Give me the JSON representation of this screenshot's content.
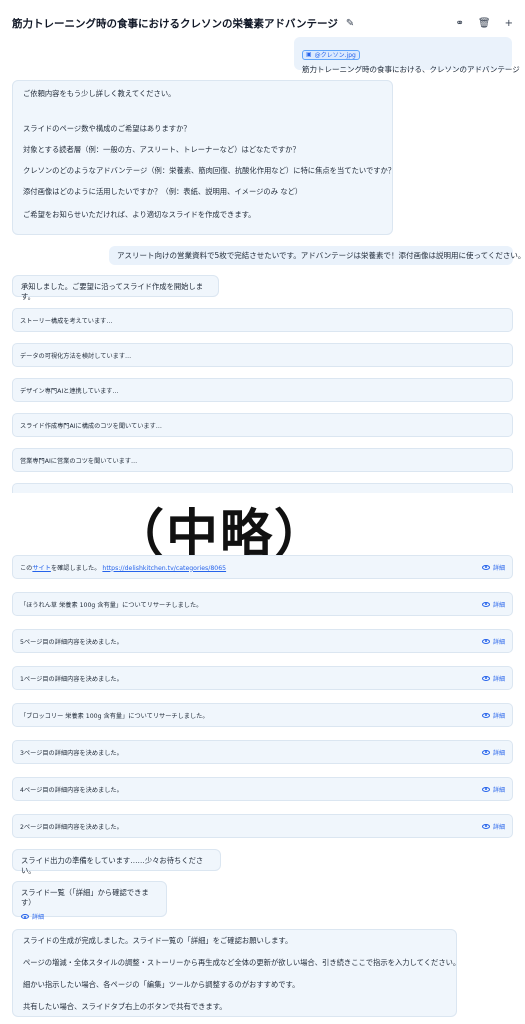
{
  "header": {
    "title": "筋力トレーニング時の食事におけるクレソンの栄養素アドバンテージ",
    "edit_icon": "pencil-icon",
    "actions": [
      "link-icon",
      "trash-icon",
      "plus-icon"
    ]
  },
  "user_msg_1": {
    "attachment": "@クレソン.jpg",
    "text": "筋力トレーニング時の食事における、クレソンのアドバンテージ"
  },
  "ai_msg_1": {
    "lines": [
      "ご依頼内容をもう少し詳しく教えてください。",
      "スライドのページ数や構成のご希望はありますか？",
      "対象とする読者層（例：一般の方、アスリート、トレーナーなど）はどなたですか？",
      "クレソンのどのようなアドバンテージ（例：栄養素、筋肉回復、抗酸化作用など）に特に焦点を当てたいですか？",
      "添付画像はどのように活用したいですか？（例：表紙、説明用、イメージのみ など）",
      "ご希望をお知らせいただければ、より適切なスライドを作成できます。"
    ]
  },
  "user_msg_2": {
    "text": "アスリート向けの営業資料で5枚で完結させたいです。アドバンテージは栄養素で！添付画像は説明用に使ってください。"
  },
  "ai_ack": "承知しました。ご要望に沿ってスライド作成を開始します。",
  "progress_steps": [
    "ストーリー構成を考えています…",
    "データの可視化方法を検討しています…",
    "デザイン専門AIと連携しています…",
    "スライド作成専門AIに構成のコツを聞いています…",
    "営業専門AIに営業のコツを聞いています…"
  ],
  "omission_label": "（中略）",
  "site_step": {
    "prefix": "この",
    "link_word": "サイト",
    "middle": "を確認しました。",
    "url": "https://delishkitchen.tv/categories/8065"
  },
  "detail_label": "詳細",
  "done_steps": [
    "「ほうれん草 栄養素 100g 含有量」についてリサーチしました。",
    "5ページ目の詳細内容を決めました。",
    "1ページ目の詳細内容を決めました。",
    "「ブロッコリー 栄養素 100g 含有量」についてリサーチしました。",
    "3ページ目の詳細内容を決めました。",
    "4ページ目の詳細内容を決めました。",
    "2ページ目の詳細内容を決めました。"
  ],
  "prep_msg": "スライド出力の準備をしています……少々お待ちください。",
  "slide_list": {
    "title": "スライド一覧（「詳細」から確認できます）",
    "detail": "詳細"
  },
  "final_msg": {
    "lines": [
      "スライドの生成が完成しました。スライド一覧の「詳細」をご確認お願いします。",
      "ページの増減・全体スタイルの調整・ストーリーから再生成など全体の更新が欲しい場合、引き続きここで指示を入力してください。",
      "細かい指示したい場合、各ページの「編集」ツールから調整するのがおすすめです。",
      "共有したい場合、スライドタブ右上のボタンで共有できます。"
    ]
  }
}
